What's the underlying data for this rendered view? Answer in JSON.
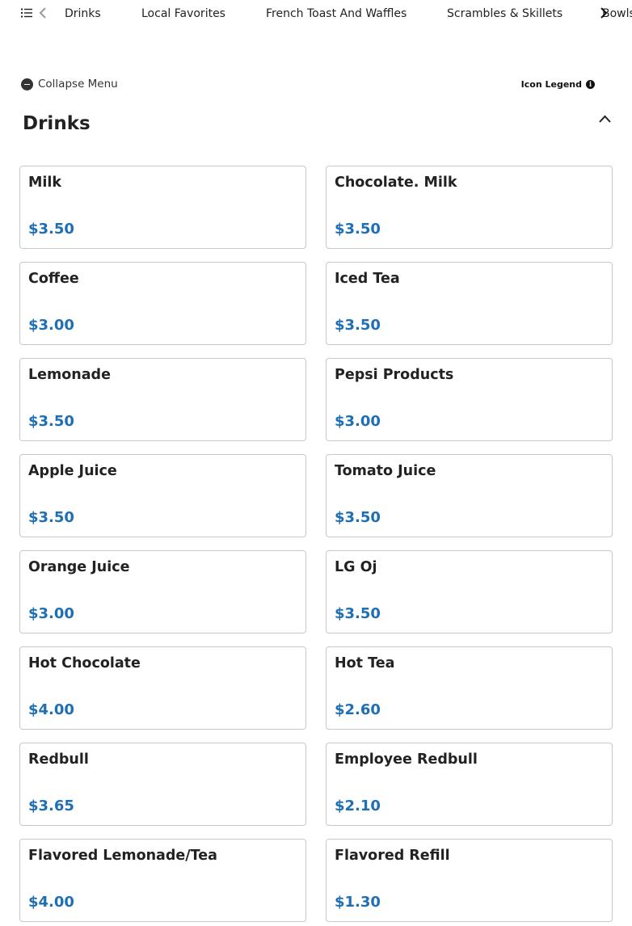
{
  "nav": {
    "tabs": [
      "Drinks",
      "Local Favorites",
      "French Toast And Waffles",
      "Scrambles & Skillets",
      "Bowls"
    ]
  },
  "menu_controls": {
    "collapse_label": "Collapse Menu",
    "legend_label": "Icon Legend"
  },
  "section": {
    "title": "Drinks"
  },
  "items": [
    {
      "name": "Milk",
      "price": "$3.50"
    },
    {
      "name": "Chocolate. Milk",
      "price": "$3.50"
    },
    {
      "name": "Coffee",
      "price": "$3.00"
    },
    {
      "name": "Iced Tea",
      "price": "$3.50"
    },
    {
      "name": "Lemonade",
      "price": "$3.50"
    },
    {
      "name": "Pepsi Products",
      "price": "$3.00"
    },
    {
      "name": "Apple Juice",
      "price": "$3.50"
    },
    {
      "name": "Tomato Juice",
      "price": "$3.50"
    },
    {
      "name": "Orange Juice",
      "price": "$3.00"
    },
    {
      "name": "LG Oj",
      "price": "$3.50"
    },
    {
      "name": "Hot Chocolate",
      "price": "$4.00"
    },
    {
      "name": "Hot Tea",
      "price": "$2.60"
    },
    {
      "name": "Redbull",
      "price": "$3.65"
    },
    {
      "name": "Employee Redbull",
      "price": "$2.10"
    },
    {
      "name": "Flavored Lemonade/Tea",
      "price": "$4.00"
    },
    {
      "name": "Flavored Refill",
      "price": "$1.30"
    }
  ],
  "colors": {
    "price": "#1f6fb5",
    "card_border": "#c8c8c8"
  },
  "icons": {
    "nav_list": "list-icon",
    "nav_prev": "chevron-left-icon",
    "nav_next": "chevron-right-icon",
    "collapse": "minus-circle-icon",
    "legend": "info-icon",
    "section_toggle": "chevron-up-icon"
  }
}
